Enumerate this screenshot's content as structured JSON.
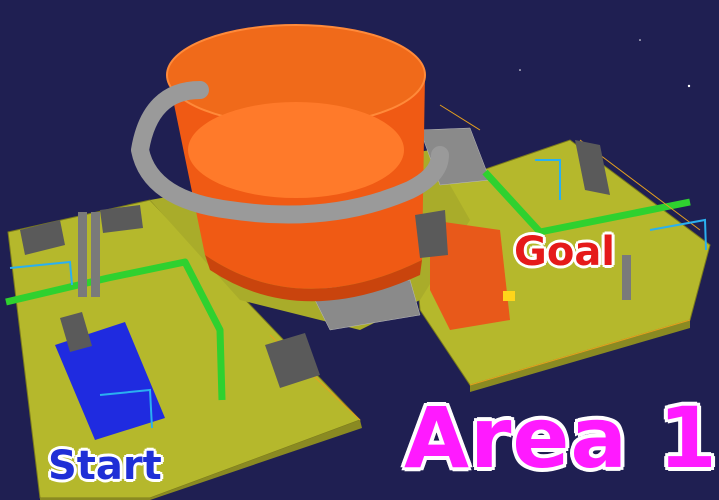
{
  "labels": {
    "goal": "Goal",
    "start": "Start",
    "area": "Area 1"
  },
  "colors": {
    "background": "#1f1f52",
    "platform": "#b5b82c",
    "tank": "#f05a14",
    "pipe_main": "#2fd12f",
    "ring_duct": "#9a9a9a",
    "railing": "#e6a01e",
    "goal_text": "#e51a1a",
    "start_text": "#1f2fd6",
    "area_text": "#ff1aff"
  }
}
